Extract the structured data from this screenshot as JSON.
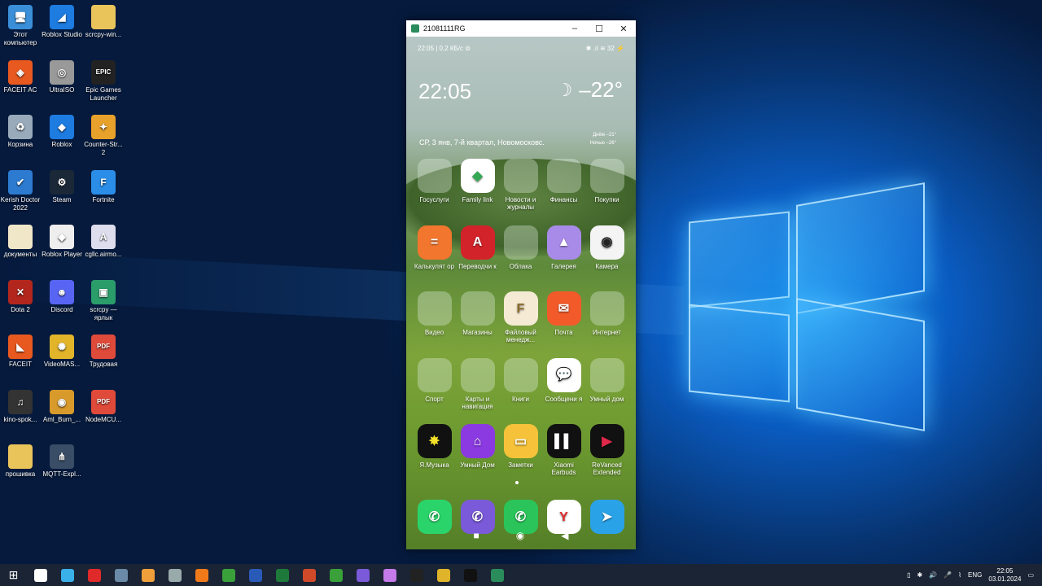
{
  "desktop_icons": [
    {
      "label": "Этот компьютер",
      "icon": "pc-icon",
      "color": "#3a8fd8",
      "glyph": "🖥"
    },
    {
      "label": "Roblox Studio",
      "icon": "roblox-studio-icon",
      "color": "#1e7be0",
      "glyph": "◢"
    },
    {
      "label": "scrcpy-win...",
      "icon": "folder-icon",
      "color": "#e9c45a",
      "glyph": ""
    },
    {
      "label": "FACEIT AC",
      "icon": "faceit-ac-icon",
      "color": "#e8591f",
      "glyph": "◈"
    },
    {
      "label": "UltraISO",
      "icon": "ultraiso-icon",
      "color": "#999",
      "glyph": "◎"
    },
    {
      "label": "Epic Games Launcher",
      "icon": "epic-games-icon",
      "color": "#222",
      "glyph": "EPIC"
    },
    {
      "label": "Корзина",
      "icon": "recycle-bin-icon",
      "color": "#9ab",
      "glyph": "♻"
    },
    {
      "label": "Roblox",
      "icon": "roblox-icon",
      "color": "#1e7be0",
      "glyph": "◆"
    },
    {
      "label": "Counter-Str... 2",
      "icon": "cs2-icon",
      "color": "#e8a12a",
      "glyph": "✦"
    },
    {
      "label": "Kerish Doctor 2022",
      "icon": "kerish-doctor-icon",
      "color": "#2d7bd1",
      "glyph": "✔"
    },
    {
      "label": "Steam",
      "icon": "steam-icon",
      "color": "#1b2838",
      "glyph": "⚙"
    },
    {
      "label": "Fortnite",
      "icon": "fortnite-icon",
      "color": "#2a8ee8",
      "glyph": "F"
    },
    {
      "label": "документы",
      "icon": "folder-icon",
      "color": "#f0e6c8",
      "glyph": ""
    },
    {
      "label": "Roblox Player",
      "icon": "roblox-player-icon",
      "color": "#eee",
      "glyph": "◆"
    },
    {
      "label": "cgllc.airmo...",
      "icon": "file-icon",
      "color": "#dde",
      "glyph": "A"
    },
    {
      "label": "Dota 2",
      "icon": "dota2-icon",
      "color": "#b3261e",
      "glyph": "✕"
    },
    {
      "label": "Discord",
      "icon": "discord-icon",
      "color": "#5865f2",
      "glyph": "☻"
    },
    {
      "label": "scrcpy — ярлык",
      "icon": "android-icon",
      "color": "#2a9d6a",
      "glyph": "▣"
    },
    {
      "label": "FACEIT",
      "icon": "faceit-icon",
      "color": "#e8591f",
      "glyph": "◣"
    },
    {
      "label": "VideoMAS...",
      "icon": "videomaster-icon",
      "color": "#e2b42a",
      "glyph": "✺"
    },
    {
      "label": "Трудовая",
      "icon": "pdf-icon",
      "color": "#e04a3a",
      "glyph": "PDF"
    },
    {
      "label": "kino-spok...",
      "icon": "guitar-icon",
      "color": "#333",
      "glyph": "♫"
    },
    {
      "label": "Aml_Burn_...",
      "icon": "aml-burn-icon",
      "color": "#d89a2a",
      "glyph": "◉"
    },
    {
      "label": "NodeMCU...",
      "icon": "pdf-icon",
      "color": "#e04a3a",
      "glyph": "PDF"
    },
    {
      "label": "прошивка",
      "icon": "folder-icon",
      "color": "#e9c45a",
      "glyph": ""
    },
    {
      "label": "MQTT-Expl...",
      "icon": "mqtt-icon",
      "color": "#3a4d66",
      "glyph": "⋔"
    }
  ],
  "window": {
    "title": "21081111RG",
    "minimize": "–",
    "maximize": "☐",
    "close": "✕"
  },
  "phone": {
    "status_left": "22:05 | 0,2 КБ/с ⊜",
    "status_right": "✱ .ıl ≋ 32 ⚡",
    "clock": "22:05",
    "temperature": "–22°",
    "date": "СР, 3 янв, 7-й квартал, Новомосковс.",
    "day_temp": "Днём –21°",
    "night_temp": "Ночью –26°",
    "apps": [
      {
        "label": "Госуслуги",
        "type": "folder"
      },
      {
        "label": "Family link",
        "type": "app",
        "color": "#ffffff",
        "glyph": "◆",
        "fg": "#34a853"
      },
      {
        "label": "Новости и журналы",
        "type": "folder"
      },
      {
        "label": "Финансы",
        "type": "folder"
      },
      {
        "label": "Покупки",
        "type": "folder"
      },
      {
        "label": "Калькулят ор",
        "type": "app",
        "color": "#f2762e",
        "glyph": "=",
        "fg": "#fff"
      },
      {
        "label": "Переводчи к",
        "type": "app",
        "color": "#d3232a",
        "glyph": "A",
        "fg": "#fff"
      },
      {
        "label": "Облака",
        "type": "folder"
      },
      {
        "label": "Галерея",
        "type": "app",
        "color": "#a88be8",
        "glyph": "▲",
        "fg": "#fff"
      },
      {
        "label": "Камера",
        "type": "app",
        "color": "#f4f4f4",
        "glyph": "◉",
        "fg": "#222"
      },
      {
        "label": "Видео",
        "type": "folder"
      },
      {
        "label": "Магазины",
        "type": "folder"
      },
      {
        "label": "Файловый менедж...",
        "type": "app",
        "color": "#f5ead4",
        "glyph": "F",
        "fg": "#8a6a2a"
      },
      {
        "label": "Почта",
        "type": "app",
        "color": "#f25a2a",
        "glyph": "✉",
        "fg": "#fff"
      },
      {
        "label": "Интернет",
        "type": "folder"
      },
      {
        "label": "Спорт",
        "type": "folder"
      },
      {
        "label": "Карты и навигация",
        "type": "folder"
      },
      {
        "label": "Книги",
        "type": "folder"
      },
      {
        "label": "Сообщени я",
        "type": "app",
        "color": "#ffffff",
        "glyph": "💬",
        "fg": "#2a6ee8"
      },
      {
        "label": "Умный дом",
        "type": "folder"
      },
      {
        "label": "Я.Музыка",
        "type": "app",
        "color": "#111111",
        "glyph": "✸",
        "fg": "#f5e02a"
      },
      {
        "label": "Умный Дом",
        "type": "app",
        "color": "#8a3ae0",
        "glyph": "⌂",
        "fg": "#fff"
      },
      {
        "label": "Заметки",
        "type": "app",
        "color": "#f5c23a",
        "glyph": "▭",
        "fg": "#fff"
      },
      {
        "label": "Xiaomi Earbuds",
        "type": "app",
        "color": "#111111",
        "glyph": "▌▌",
        "fg": "#fff"
      },
      {
        "label": "ReVanced Extended",
        "type": "app",
        "color": "#111111",
        "glyph": "▶",
        "fg": "#e0284a"
      }
    ],
    "dock": [
      {
        "name": "phone",
        "color": "#2bd46a",
        "glyph": "✆"
      },
      {
        "name": "viber",
        "color": "#7a5ad8",
        "glyph": "✆"
      },
      {
        "name": "whatsapp",
        "color": "#2bc45a",
        "glyph": "✆"
      },
      {
        "name": "yandex",
        "color": "#ffffff",
        "glyph": "Y"
      },
      {
        "name": "telegram",
        "color": "#2aa2e8",
        "glyph": "➤"
      }
    ]
  },
  "taskbar": {
    "items": [
      "#fff",
      "#3ab0e8",
      "#e02a2a",
      "#6a8aa8",
      "#f0a03a",
      "#9aa",
      "#f07a1a",
      "#3aa03a",
      "#2a5ab8",
      "#1e7a3a",
      "#d04a2a",
      "#3aa03a",
      "#7a5ad8",
      "#c47ae8",
      "#222",
      "#e0b42a",
      "#111",
      "#2a8c5a"
    ],
    "lang": "ENG",
    "time": "22:05",
    "date": "03.01.2024"
  }
}
